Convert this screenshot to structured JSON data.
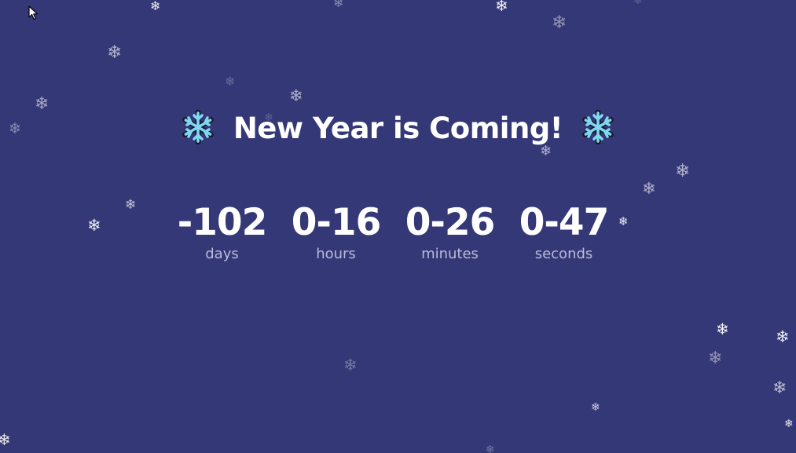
{
  "page": {
    "title": "New Year is Coming!",
    "title_icon": "snowflake-emoji",
    "background_color": "#353877",
    "accent_color": "#7fd8f2"
  },
  "countdown": {
    "days": {
      "value": "-102",
      "label": "days"
    },
    "hours": {
      "value": "0-16",
      "label": "hours"
    },
    "minutes": {
      "value": "0-26",
      "label": "minutes"
    },
    "seconds": {
      "value": "0-47",
      "label": "seconds"
    }
  },
  "decoration": {
    "icon": "snowflake-icon",
    "glyph": "❄"
  }
}
